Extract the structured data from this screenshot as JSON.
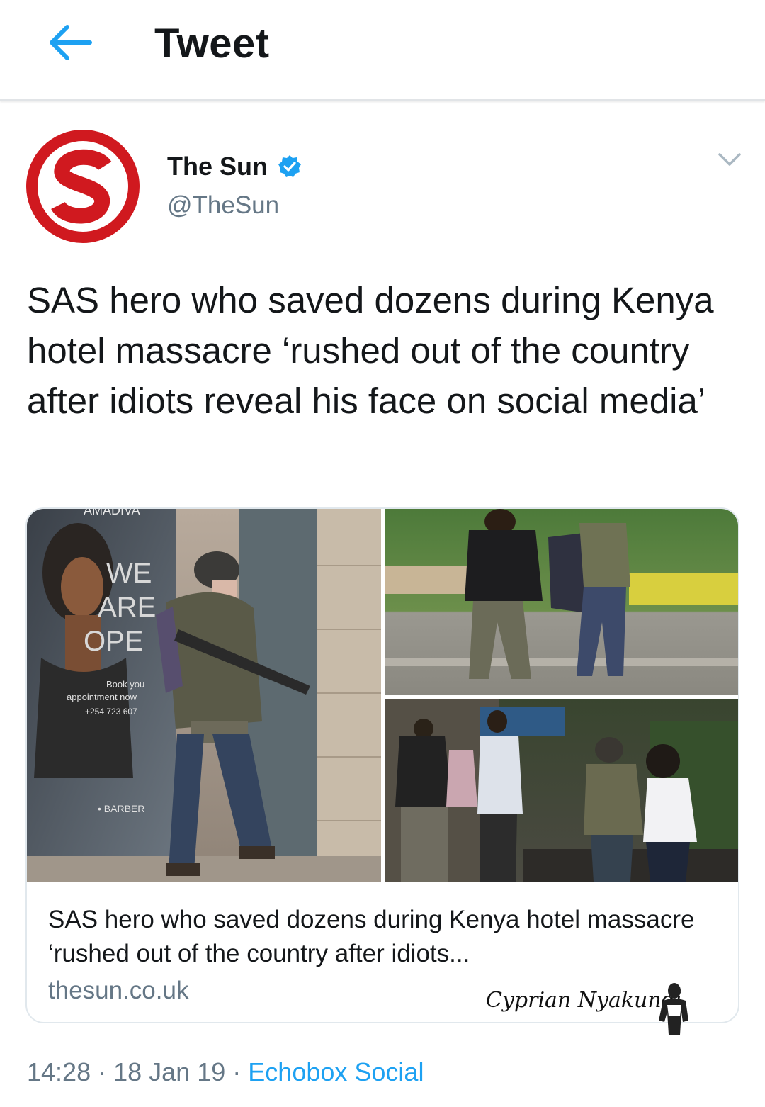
{
  "header": {
    "title": "Tweet"
  },
  "tweet": {
    "author_name": "The Sun",
    "author_handle": "@TheSun",
    "text": "SAS hero who saved dozens during Kenya hotel massacre ‘rushed out of the country after idiots reveal his face on social media’",
    "card": {
      "title": "SAS hero who saved dozens during Kenya hotel massacre ‘rushed out of the country after idiots...",
      "domain": "thesun.co.uk",
      "photo_texts": {
        "poster_brand": "AMADIVA",
        "poster_line1": "WE",
        "poster_line2": "ARE",
        "poster_line3": "OPE",
        "poster_book": "Book you",
        "poster_appointment": "appointment now",
        "poster_phone": "+254 723 607",
        "poster_barber": "• BARBER"
      }
    },
    "time": "14:28",
    "date": "18 Jan 19",
    "source": "Echobox Social",
    "separator": "·"
  },
  "watermark": {
    "signature": "Cyprian Nyakundi"
  },
  "colors": {
    "accent": "#1da1f2",
    "secondary_text": "#657786",
    "logo_red": "#d0191f",
    "card_border": "#e1e8ed"
  },
  "icons": {
    "back": "arrow-left-icon",
    "verified": "verified-badge-icon",
    "caret": "chevron-down-icon"
  }
}
